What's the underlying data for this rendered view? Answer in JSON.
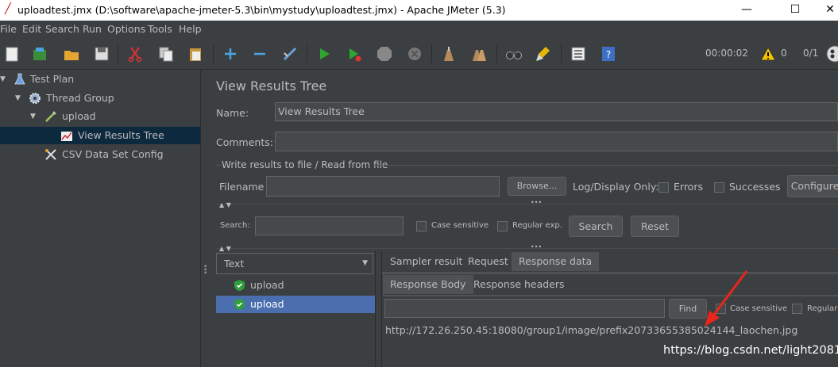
{
  "window": {
    "title": "uploadtest.jmx (D:\\software\\apache-jmeter-5.3\\bin\\mystudy\\uploadtest.jmx) - Apache JMeter (5.3)",
    "minimize": "—",
    "maximize": "☐",
    "close": "✕"
  },
  "menu": [
    "File",
    "Edit",
    "Search",
    "Run",
    "Options",
    "Tools",
    "Help"
  ],
  "toolbar": {
    "timer": "00:00:02",
    "warnings": "0",
    "threads": "0/1"
  },
  "tree": [
    {
      "label": "Test Plan",
      "icon": "flask-icon"
    },
    {
      "label": "Thread Group",
      "icon": "gear-icon"
    },
    {
      "label": "upload",
      "icon": "pipette-icon"
    },
    {
      "label": "View Results Tree",
      "icon": "chart-icon"
    },
    {
      "label": "CSV Data Set Config",
      "icon": "wrench-icon"
    }
  ],
  "panel": {
    "title": "View Results Tree",
    "name_label": "Name:",
    "name_value": "View Results Tree",
    "comments_label": "Comments:",
    "comments_value": "",
    "file_section": "Write results to file / Read from file",
    "filename_label": "Filename",
    "filename_value": "",
    "browse": "Browse...",
    "log_display": "Log/Display Only:",
    "errors": "Errors",
    "successes": "Successes",
    "configure": "Configure"
  },
  "search": {
    "label": "Search:",
    "value": "",
    "case_sensitive": "Case sensitive",
    "regular_exp": "Regular exp.",
    "search_btn": "Search",
    "reset_btn": "Reset"
  },
  "results": {
    "renderer": "Text",
    "samples": [
      "upload",
      "upload"
    ],
    "tabs": [
      "Sampler result",
      "Request",
      "Response data"
    ],
    "subtabs": [
      "Response Body",
      "Response headers"
    ],
    "find_btn": "Find",
    "find_case": "Case sensitive",
    "find_regular": "Regular",
    "response_body": "http://172.26.250.45:18080/group1/image/prefix20733655385024144_laochen.jpg"
  },
  "watermark": "https://blog.csdn.net/light2081",
  "colors": {
    "accent": "#4b6eaf",
    "selected_tree": "#0d293e",
    "annotation": "#e8261b"
  }
}
